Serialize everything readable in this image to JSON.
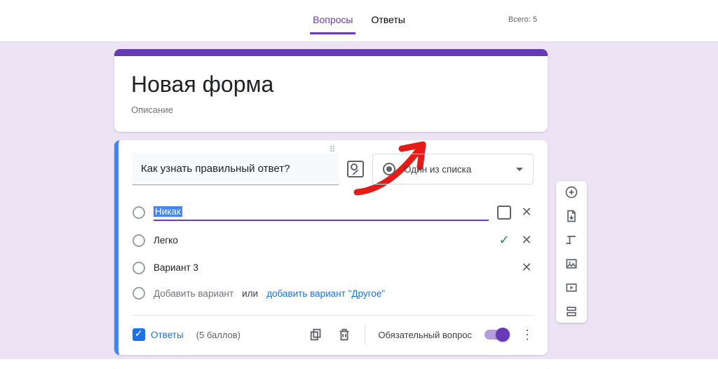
{
  "tabs": {
    "questions": "Вопросы",
    "responses": "Ответы"
  },
  "total_label": "Всего: 5",
  "form": {
    "title": "Новая форма",
    "description": "Описание"
  },
  "question": {
    "text": "Как узнать правильный ответ?",
    "type_label": "Один из списка",
    "options": [
      "Никак",
      "Легко",
      "Вариант 3"
    ],
    "add_option": "Добавить вариант",
    "or": "или",
    "add_other": "добавить вариант \"Другое\""
  },
  "footer": {
    "answers": "Ответы",
    "points": "(5 баллов)",
    "required": "Обязательный вопрос"
  }
}
